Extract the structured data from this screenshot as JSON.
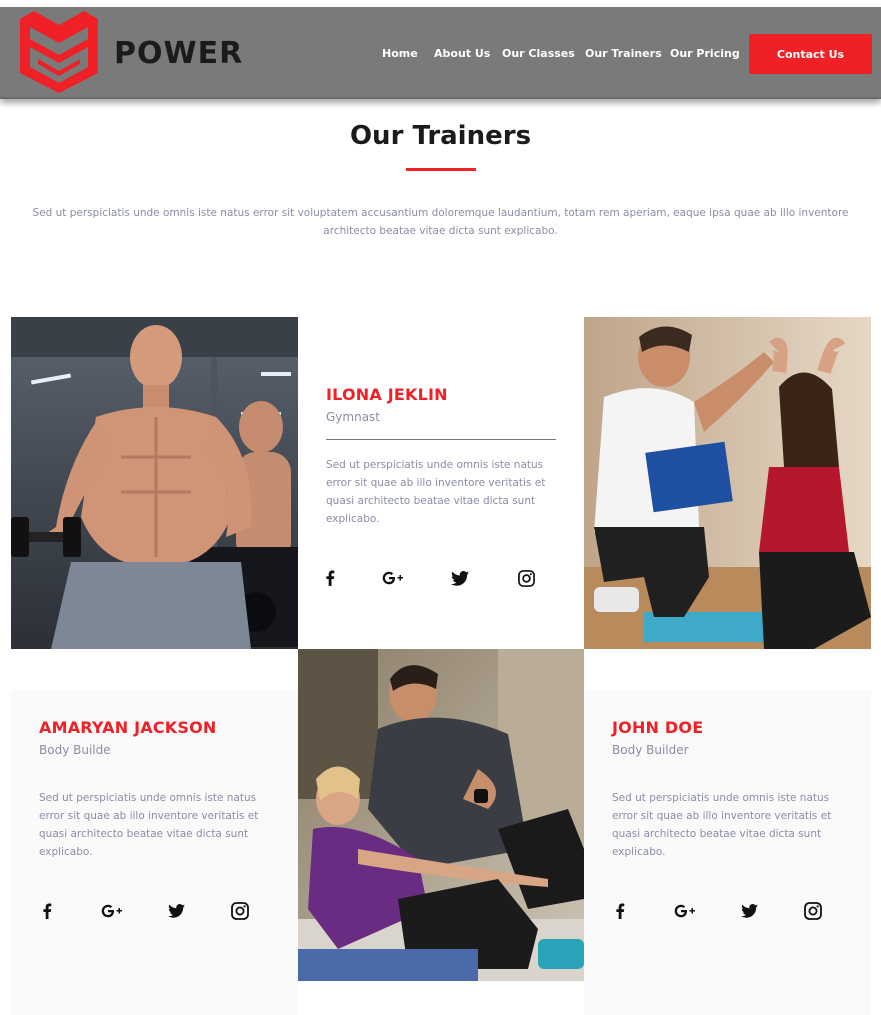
{
  "header": {
    "brand": "POWER",
    "nav": [
      "Home",
      "About Us",
      "Our Classes",
      "Our Trainers",
      "Our Pricing"
    ],
    "contact_label": "Contact Us",
    "accent": "#ef2026",
    "bg": "#7a7a7a"
  },
  "section": {
    "title": "Our Trainers",
    "description": "Sed ut perspiciatis unde omnis iste natus error sit voluptatem accusantium doloremque laudantium, totam rem aperiam, eaque ipsa quae ab illo inventore architecto beatae vitae dicta sunt explicabo."
  },
  "trainers": [
    {
      "name": "ILONA JEKLIN",
      "role": "Gymnast",
      "bio": "Sed ut perspiciatis unde omnis iste natus error sit quae ab illo inventore veritatis et quasi architecto beatae vitae dicta sunt explicabo."
    },
    {
      "name": "AMARYAN JACKSON",
      "role": "Body Builde",
      "bio": "Sed ut perspiciatis unde omnis iste natus error sit quae ab illo inventore veritatis et quasi architecto beatae vitae dicta sunt explicabo."
    },
    {
      "name": "JOHN DOE",
      "role": "Body Builder",
      "bio": "Sed ut perspiciatis unde omnis iste natus error sit quae ab illo inventore veritatis et quasi architecto beatae vitae dicta sunt explicabo."
    }
  ],
  "social_icons": [
    "facebook-icon",
    "google-plus-icon",
    "twitter-icon",
    "instagram-icon"
  ]
}
